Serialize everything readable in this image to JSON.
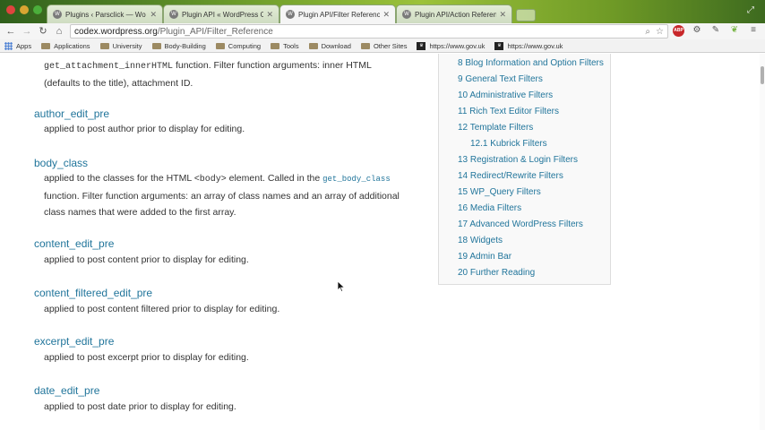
{
  "browser": {
    "tabs": [
      {
        "title": "Plugins ‹ Parsclick — Wo",
        "active": false
      },
      {
        "title": "Plugin API « WordPress C",
        "active": false
      },
      {
        "title": "Plugin API/Filter Referenc",
        "active": true
      },
      {
        "title": "Plugin API/Action Referen",
        "active": false
      }
    ],
    "url_host": "codex.wordpress.org",
    "url_path": "/Plugin_API/Filter_Reference",
    "extensions": [
      "star-icon",
      "abp-icon",
      "gear-icon",
      "pen-icon",
      "leaf-icon",
      "menu-icon"
    ],
    "abp_label": "ABP"
  },
  "bookmarks": [
    {
      "label": "Apps",
      "icon": "apps-grid-icon"
    },
    {
      "label": "Applications",
      "icon": "folder-icon"
    },
    {
      "label": "University",
      "icon": "folder-icon"
    },
    {
      "label": "Body-Building",
      "icon": "folder-icon"
    },
    {
      "label": "Computing",
      "icon": "folder-icon"
    },
    {
      "label": "Tools",
      "icon": "folder-icon"
    },
    {
      "label": "Download",
      "icon": "folder-icon"
    },
    {
      "label": "Other Sites",
      "icon": "folder-icon"
    },
    {
      "label": "https://www.gov.uk",
      "icon": "govuk-icon"
    },
    {
      "label": "https://www.gov.uk",
      "icon": "govuk-icon"
    }
  ],
  "content": {
    "intro": {
      "code": "get_attachment_innerHTML",
      "text_after_code": " function. Filter function arguments: inner HTML",
      "line2": "(defaults to the title), attachment ID."
    },
    "author_edit_pre": {
      "title": "author_edit_pre",
      "desc": "applied to post author prior to display for editing."
    },
    "body_class": {
      "title": "body_class",
      "desc_a": "applied to the classes for the HTML ",
      "code_body": "<body>",
      "desc_b": " element. Called in the ",
      "code_fn": "get_body_class",
      "line2": "function. Filter function arguments: an array of class names and an array of additional",
      "line3": "class names that were added to the first array."
    },
    "content_edit_pre": {
      "title": "content_edit_pre",
      "desc": "applied to post content prior to display for editing."
    },
    "content_filtered_edit_pre": {
      "title": "content_filtered_edit_pre",
      "desc": "applied to post content filtered prior to display for editing."
    },
    "excerpt_edit_pre": {
      "title": "excerpt_edit_pre",
      "desc": "applied to post excerpt prior to display for editing."
    },
    "date_edit_pre": {
      "title": "date_edit_pre",
      "desc": "applied to post date prior to display for editing."
    }
  },
  "toc": [
    "8 Blog Information and Option Filters",
    "9 General Text Filters",
    "10 Administrative Filters",
    "11 Rich Text Editor Filters",
    "12 Template Filters",
    "12.1 Kubrick Filters",
    "13 Registration & Login Filters",
    "14 Redirect/Rewrite Filters",
    "15 WP_Query Filters",
    "16 Media Filters",
    "17 Advanced WordPress Filters",
    "18 Widgets",
    "19 Admin Bar",
    "20 Further Reading"
  ]
}
